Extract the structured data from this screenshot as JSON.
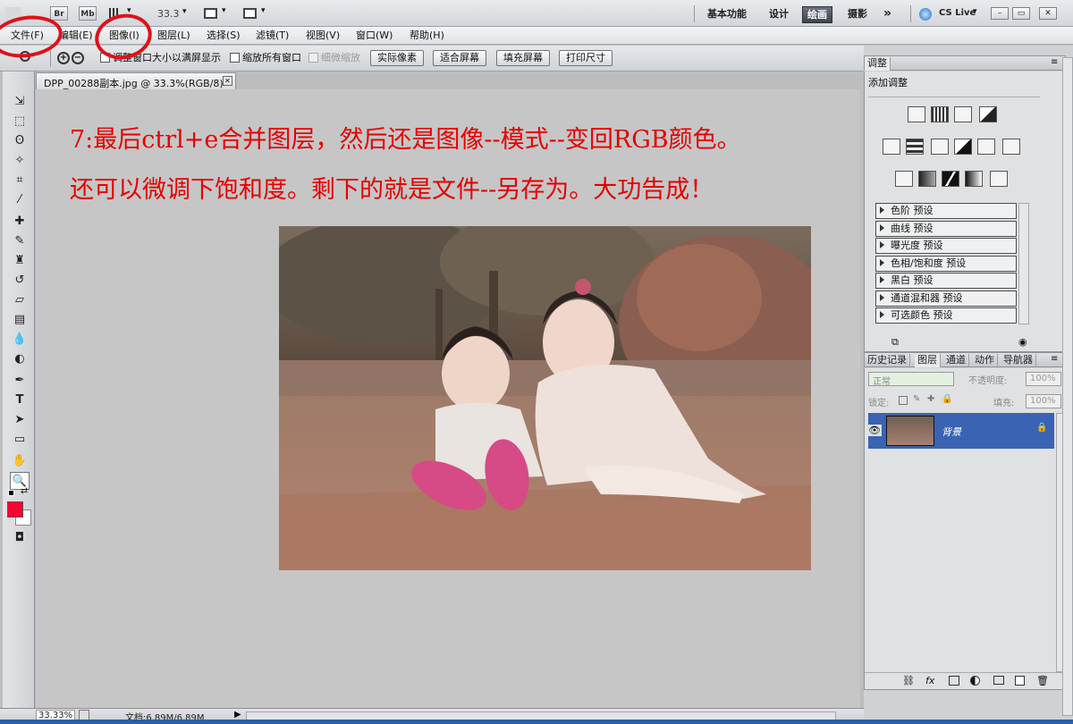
{
  "app_bar": {
    "bridge": "Br",
    "minibridge": "Mb",
    "zoom": "33.3",
    "workspaces": [
      "基本功能",
      "设计",
      "绘画",
      "摄影"
    ],
    "more": "»",
    "cs_live": "CS Live"
  },
  "menubar": {
    "items": [
      "文件(F)",
      "编辑(E)",
      "图像(I)",
      "图层(L)",
      "选择(S)",
      "滤镜(T)",
      "视图(V)",
      "窗口(W)",
      "帮助(H)"
    ]
  },
  "options": {
    "resize_windows": "调整窗口大小以满屏显示",
    "zoom_all": "缩放所有窗口",
    "scrubby_zoom": "细微缩放",
    "buttons": [
      "实际像素",
      "适合屏幕",
      "填充屏幕",
      "打印尺寸"
    ]
  },
  "document": {
    "tab_title": "DPP_00288副本.jpg @ 33.3%(RGB/8)",
    "line1": "7:最后ctrl+e合并图层，然后还是图像--模式--变回RGB颜色。",
    "line2": "还可以微调下饱和度。剩下的就是文件--另存为。大功告成！"
  },
  "status": {
    "zoom": "33.33%",
    "doc": "文档:6.89M/6.89M"
  },
  "adjustments": {
    "tab": "调整",
    "title": "添加调整",
    "presets": [
      "色阶 预设",
      "曲线 预设",
      "曝光度 预设",
      "色相/饱和度 预设",
      "黑白 预设",
      "通道混和器 预设",
      "可选颜色 预设"
    ]
  },
  "layers_panel": {
    "tabs": [
      "历史记录",
      "图层",
      "通道",
      "动作",
      "导航器"
    ],
    "blend_mode": "正常",
    "opacity_label": "不透明度:",
    "opacity_value": "100%",
    "lock_label": "锁定:",
    "fill_label": "填充:",
    "fill_value": "100%",
    "layer_name": "背景"
  },
  "colors": {
    "foreground": "#ff0033",
    "background": "#ffffff",
    "annotation": "#e0101a",
    "text_red": "#e60000"
  }
}
